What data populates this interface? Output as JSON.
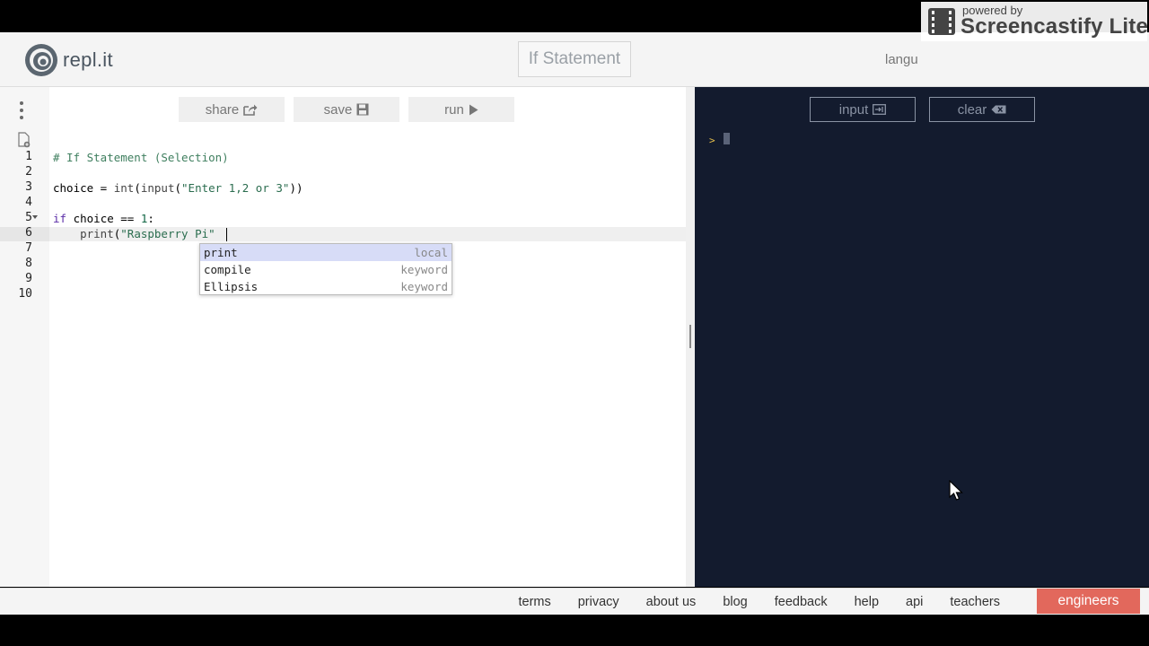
{
  "header": {
    "logo_text": "repl.it",
    "project_title": "If Statement",
    "language_partial": "langu"
  },
  "watermark": {
    "powered_by": "powered by",
    "brand": "Screencastify Lite"
  },
  "toolbar": {
    "share_label": "share",
    "save_label": "save",
    "run_label": "run"
  },
  "editor": {
    "line_numbers": [
      "1",
      "2",
      "3",
      "4",
      "5",
      "6",
      "7",
      "8",
      "9",
      "10"
    ],
    "lines": {
      "l1": "# If Statement (Selection)",
      "l3_a": "choice = ",
      "l3_b": "int",
      "l3_c": "(",
      "l3_d": "input",
      "l3_e": "(",
      "l3_f": "\"Enter 1,2 or 3\"",
      "l3_g": "))",
      "l5_a": "if",
      "l5_b": " choice == ",
      "l5_c": "1",
      "l5_d": ":",
      "l6_a": "    ",
      "l6_b": "print",
      "l6_c": "(",
      "l6_d": "\"Raspberry Pi\""
    }
  },
  "autocomplete": [
    {
      "name": "print",
      "kind": "local"
    },
    {
      "name": "compile",
      "kind": "keyword"
    },
    {
      "name": "Ellipsis",
      "kind": "keyword"
    }
  ],
  "console": {
    "input_label": "input",
    "clear_label": "clear",
    "prompt_symbol": ">"
  },
  "footer": {
    "links": [
      "terms",
      "privacy",
      "about us",
      "blog",
      "feedback",
      "help",
      "api",
      "teachers"
    ],
    "engineers_label": "engineers"
  },
  "colors": {
    "console_bg": "#131b2e",
    "engineers_bg": "#e2685c",
    "autocomplete_selected": "#d7dcf7"
  }
}
